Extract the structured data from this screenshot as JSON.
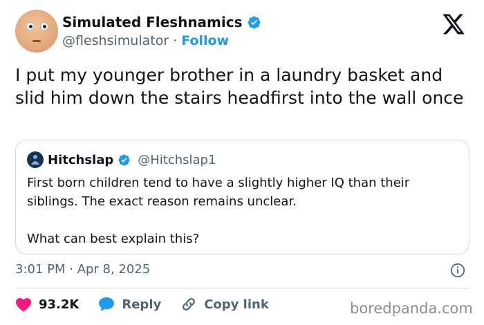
{
  "author": {
    "display_name": "Simulated Fleshnamics",
    "handle": "@fleshsimulator",
    "separator": "·",
    "follow_label": "Follow"
  },
  "tweet": {
    "text": "I put my younger brother in a laundry basket and slid him down the stairs headfirst into the wall once",
    "timestamp": "3:01 PM · Apr 8, 2025"
  },
  "quoted": {
    "display_name": "Hitchslap",
    "handle": "@Hitchslap1",
    "paragraph1": "First born children tend to have a slightly higher IQ than their siblings. The exact reason remains unclear.",
    "paragraph2": "What can best explain this?"
  },
  "actions": {
    "likes": "93.2K",
    "reply_label": "Reply",
    "copy_link_label": "Copy link"
  },
  "watermark": "boredpanda.com",
  "icons": {
    "verified": "verified-badge-icon",
    "platform": "x-logo-icon",
    "info": "info-icon",
    "like": "heart-icon",
    "reply": "speech-bubble-icon",
    "copy": "link-icon"
  },
  "colors": {
    "accent": "#1d9bf0",
    "heart": "#f91880",
    "secondary_text": "#536471",
    "border": "#cfd9de"
  }
}
